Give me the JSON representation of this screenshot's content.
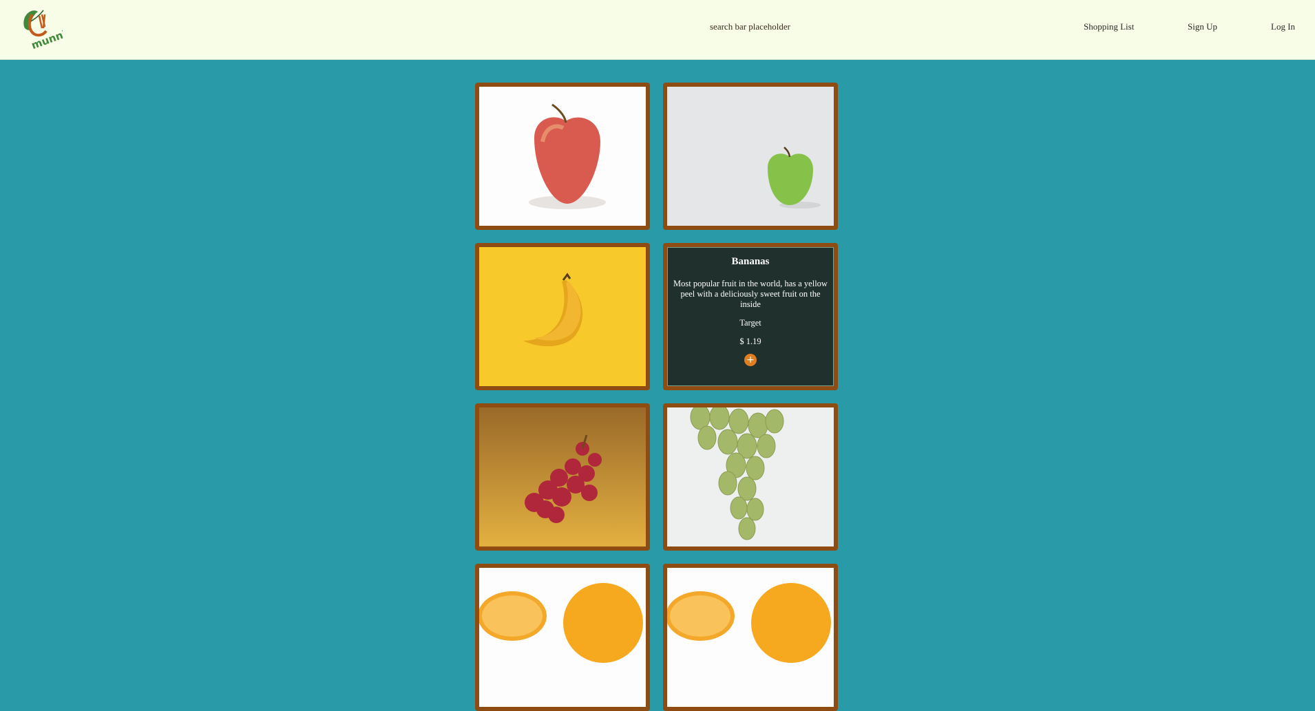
{
  "header": {
    "logo_text": "munni",
    "search_placeholder": "search bar placeholder",
    "nav": {
      "shopping_list": "Shopping List",
      "sign_up": "Sign Up",
      "log_in": "Log In"
    }
  },
  "colors": {
    "page_bg": "#289aa8",
    "header_bg": "#f7fde6",
    "card_border": "#8e4b12",
    "detail_bg": "#20302c",
    "add_button": "#e07e22"
  },
  "products": [
    {
      "image": "red-apple"
    },
    {
      "image": "green-apple"
    },
    {
      "image": "bananas"
    },
    {
      "name": "Bananas",
      "description": "Most popular fruit in the world, has a yellow peel with a deliciously sweet fruit on the inside",
      "store": "Target",
      "price": "$ 1.19",
      "add_icon": "+"
    },
    {
      "image": "red-grapes"
    },
    {
      "image": "green-grapes"
    },
    {
      "image": "orange"
    },
    {
      "image": "orange"
    }
  ]
}
